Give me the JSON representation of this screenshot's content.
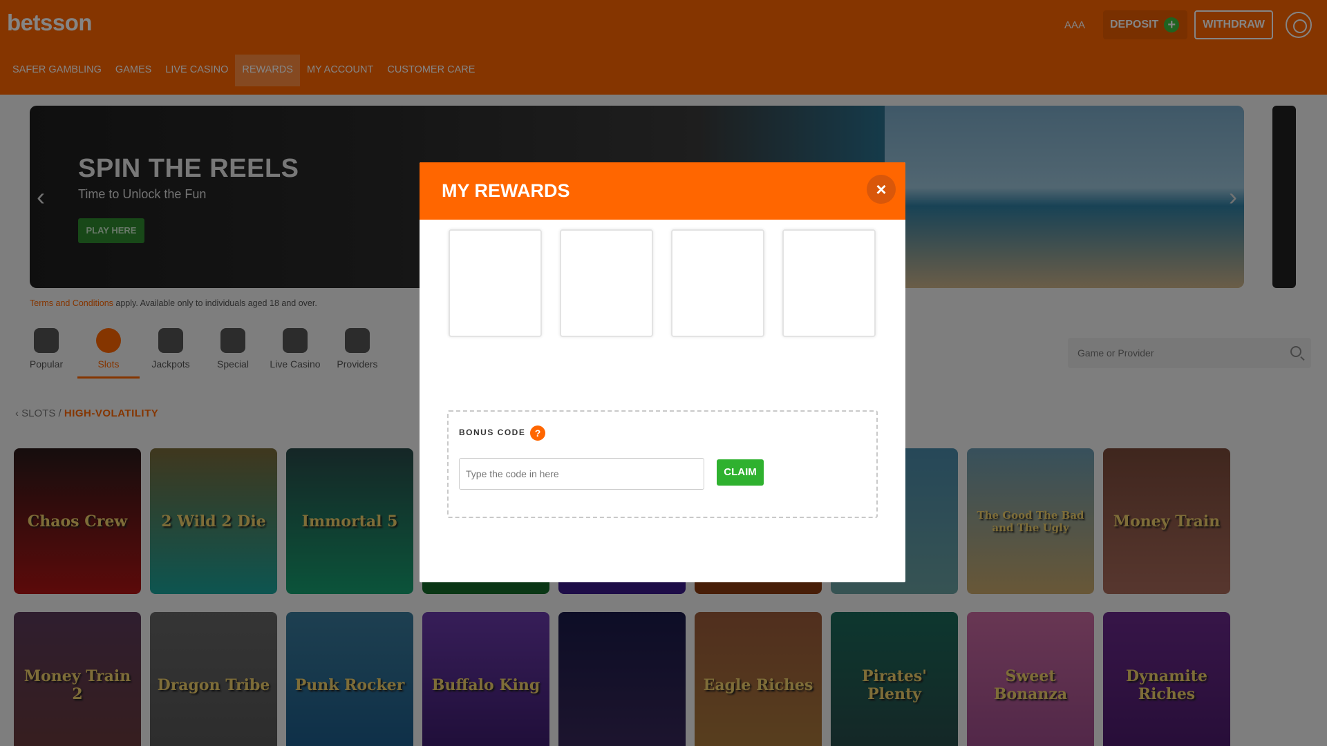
{
  "header": {
    "logo": "betsson",
    "accessibility_label": "AAA",
    "deposit_label": "DEPOSIT",
    "withdraw_label": "WITHDRAW"
  },
  "nav": {
    "items": [
      "SAFER GAMBLING",
      "GAMES",
      "LIVE CASINO",
      "REWARDS",
      "MY ACCOUNT",
      "CUSTOMER CARE"
    ],
    "active": "REWARDS"
  },
  "banner": {
    "title": "SPIN THE REELS",
    "subtitle": "Time to Unlock the Fun",
    "cta_label": "PLAY HERE"
  },
  "terms": {
    "link": "Terms and Conditions",
    "text": " apply. Available only to individuals aged 18 and over."
  },
  "categories": {
    "items": [
      "Popular",
      "Slots",
      "Jackpots",
      "Special",
      "Live Casino",
      "Providers"
    ],
    "active": "Slots"
  },
  "search": {
    "placeholder": "Game or Provider"
  },
  "breadcrumb": {
    "parent": "SLOTS",
    "separator": "/",
    "current": "HIGH-VOLATILITY"
  },
  "games": {
    "row1": [
      "Chaos Crew",
      "2 Wild 2 Die",
      "Immortal 5",
      "",
      "",
      "",
      "",
      "The Good The Bad and The Ugly",
      "Money Train"
    ],
    "row2": [
      "Money Train 2",
      "Dragon Tribe",
      "Punk Rocker",
      "Buffalo King",
      "",
      "Eagle Riches",
      "Pirates' Plenty",
      "Sweet Bonanza",
      "Dynamite Riches"
    ]
  },
  "modal": {
    "title": "MY REWARDS",
    "close_icon": "close-icon",
    "bonus_code_label": "BONUS CODE",
    "help_glyph": "?",
    "code_input_placeholder": "Type the code in here",
    "code_input_value": "",
    "claim_label": "CLAIM"
  },
  "colors": {
    "brand": "#ff6600",
    "claim": "#2fb12f",
    "play": "#2e8b2e"
  }
}
